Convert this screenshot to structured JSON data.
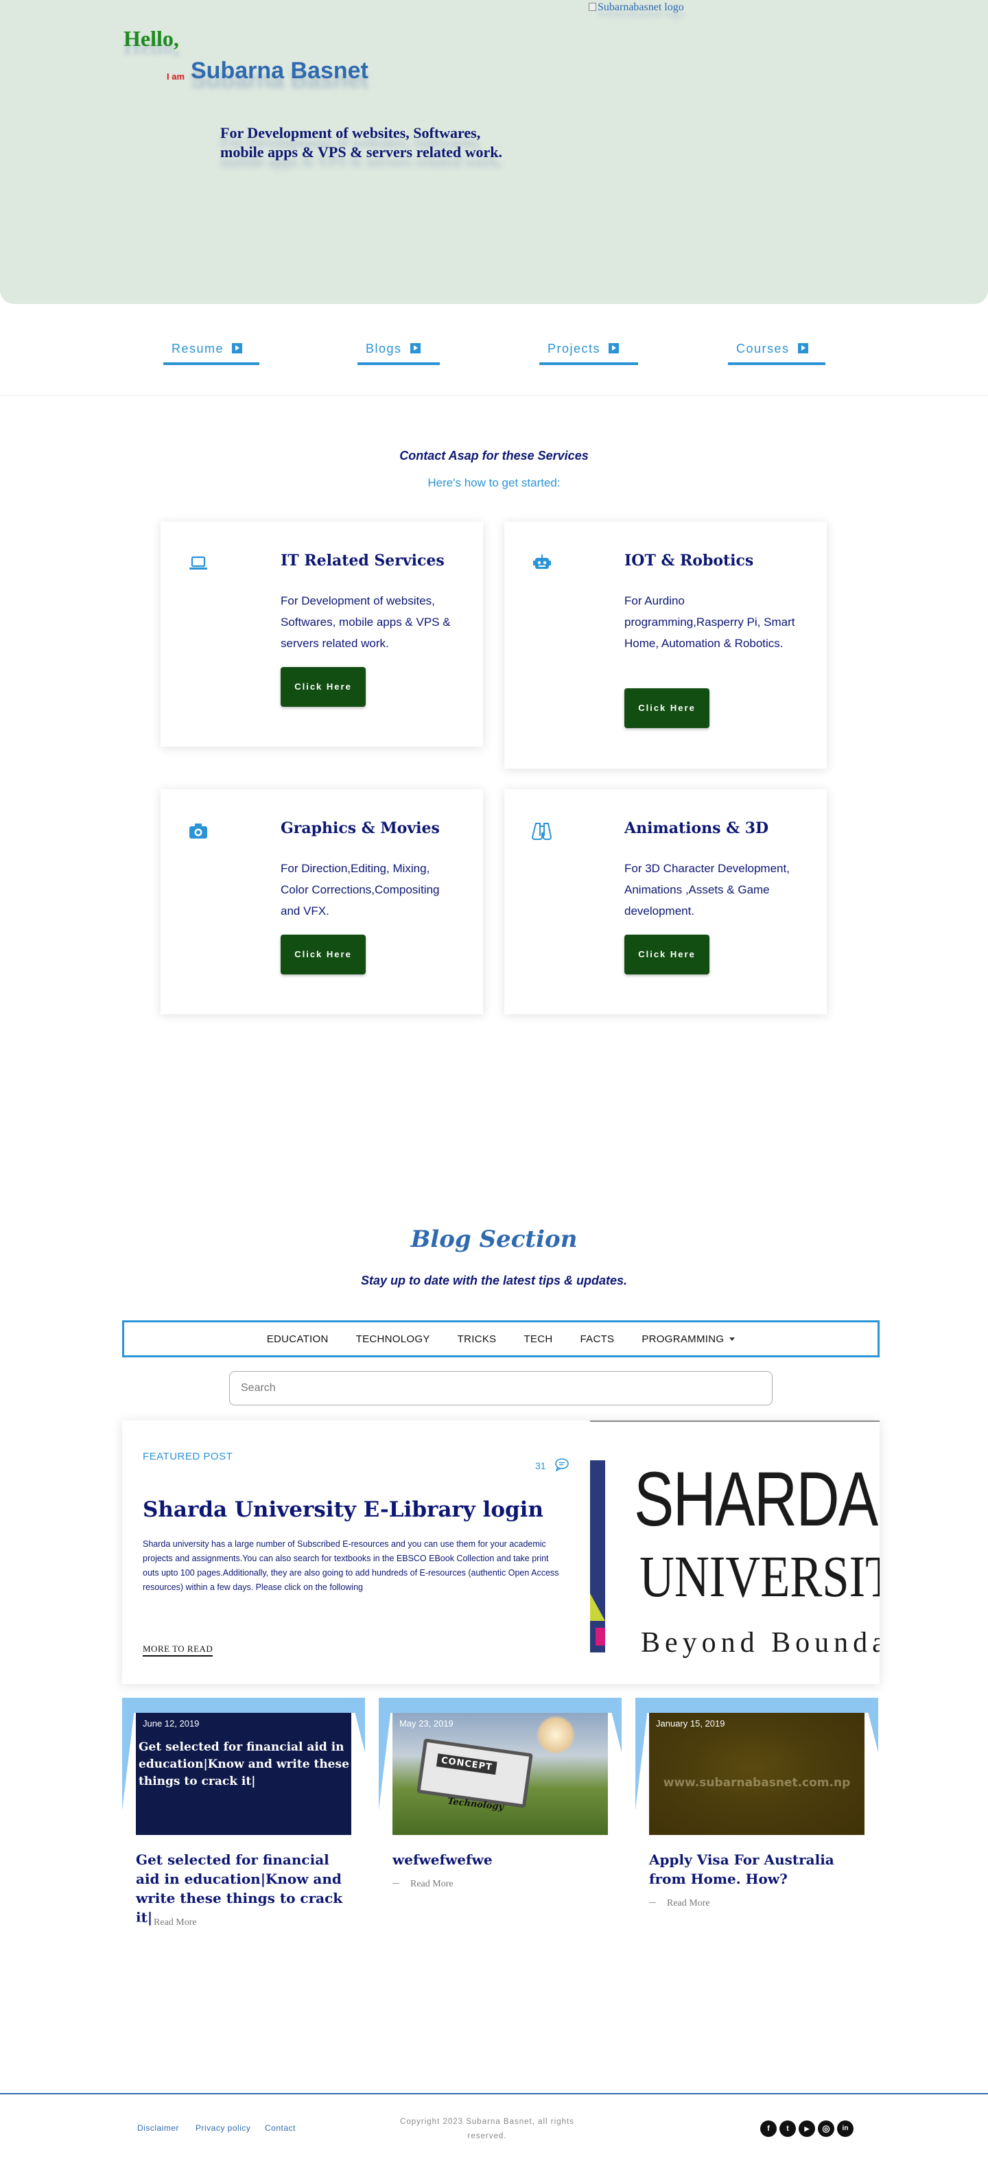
{
  "hero": {
    "greeting": "Hello,",
    "i_am": "I am",
    "name": "Subarna Basnet",
    "logo_alt": "Subarnabasnet logo",
    "tagline": "For Development of websites, Softwares, mobile apps & VPS & servers related work."
  },
  "topnav": {
    "items": [
      {
        "label": "Resume"
      },
      {
        "label": "Blogs"
      },
      {
        "label": "Projects"
      },
      {
        "label": "Courses"
      }
    ]
  },
  "services": {
    "title": "Contact Asap for these Services",
    "subtitle": "Here's how to get started:",
    "cards": [
      {
        "icon": "laptop-icon",
        "title": "IT Related Services",
        "text": "For Development of websites, Softwares, mobile apps & VPS & servers related work.",
        "button": "Click Here"
      },
      {
        "icon": "robot-icon",
        "title": "IOT & Robotics",
        "text": "For Aurdino programming,Rasperry Pi, Smart Home, Automation & Robotics.",
        "button": "Click Here"
      },
      {
        "icon": "camera-icon",
        "title": "Graphics & Movies",
        "text": "For Direction,Editing, Mixing, Color Corrections,Compositing and VFX.",
        "button": "Click Here"
      },
      {
        "icon": "binoculars-icon",
        "title": "Animations & 3D",
        "text": "For 3D Character Development, Animations ,Assets & Game development.",
        "button": "Click Here"
      }
    ]
  },
  "blog": {
    "title": "Blog Section",
    "subtitle": "Stay up to date with the latest tips & updates.",
    "nav": [
      "EDUCATION",
      "TECHNOLOGY",
      "TRICKS",
      "TECH",
      "FACTS",
      "PROGRAMMING"
    ],
    "search_placeholder": "Search",
    "featured": {
      "label": "FEATURED POST",
      "comment_count": "31",
      "title": "Sharda University E-Library login",
      "excerpt": "Sharda university has a large number of Subscribed E-resources and you can use them for your academic projects and assignments.You can also search for textbooks in the EBSCO EBook Collection and take print outs upto 100 pages.Additionally, they are also going to add hundreds of E-resources (authentic Open Access resources) within a few days. Please click on the following",
      "more": "MORE TO READ",
      "image_lines": [
        "SHARDA",
        "UNIVERSITY",
        "Beyond Boundaries"
      ]
    },
    "posts": [
      {
        "date": "June 12, 2019",
        "title": "Get selected for financial aid in education|Know and write these things to crack it|",
        "thumb_text": "Get selected for financial aid in education|Know and write these things to crack it|",
        "more": "Read More"
      },
      {
        "date": "May 23, 2019",
        "title": "wefwefwefwe",
        "thumb_text": "CONCEPT",
        "thumb_text2": "Technology",
        "more": "Read More"
      },
      {
        "date": "January 15, 2019",
        "title": "Apply Visa For Australia from Home. How?",
        "thumb_text": "www.subarnabasnet.com.np",
        "more": "Read More"
      }
    ]
  },
  "footer": {
    "links": [
      "Disclaimer",
      "Privacy policy",
      "Contact"
    ],
    "copyright": "Copyright 2023 Subarna Basnet, all rights reserved.",
    "social": [
      {
        "icon": "facebook-icon",
        "glyph": "f"
      },
      {
        "icon": "twitter-icon",
        "glyph": "t"
      },
      {
        "icon": "youtube-icon",
        "glyph": "▶"
      },
      {
        "icon": "instagram-icon",
        "glyph": "◎"
      },
      {
        "icon": "linkedin-icon",
        "glyph": "in"
      }
    ]
  }
}
